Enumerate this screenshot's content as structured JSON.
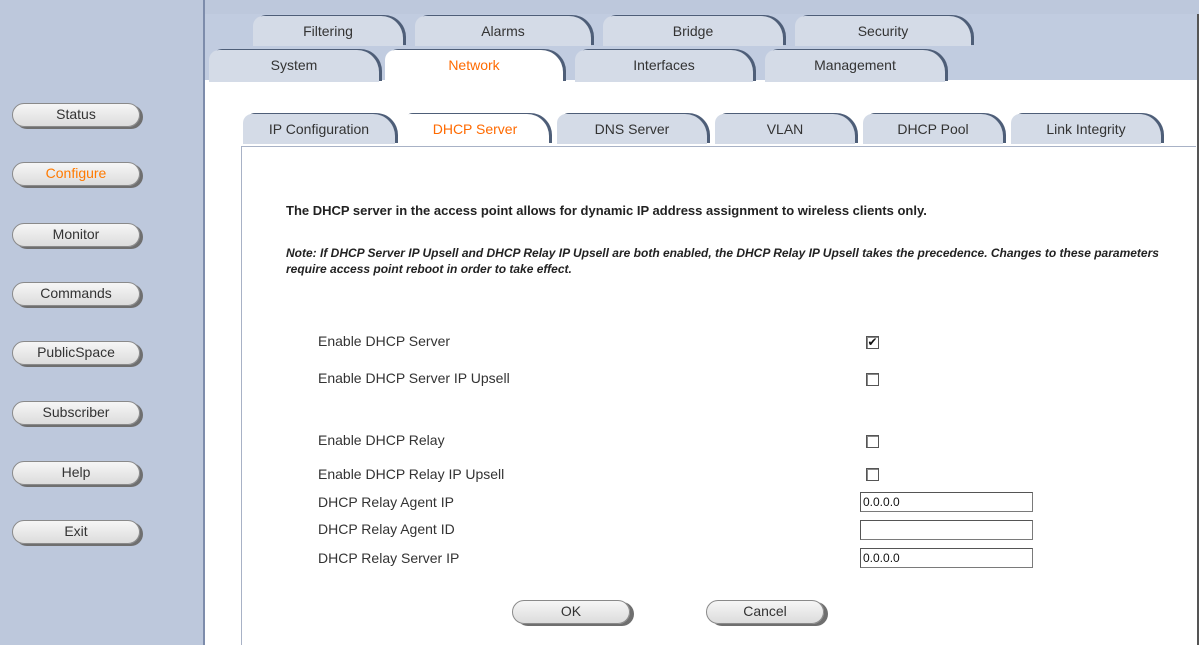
{
  "sidebar": {
    "items": [
      {
        "label": "Status",
        "active": false
      },
      {
        "label": "Configure",
        "active": true
      },
      {
        "label": "Monitor",
        "active": false
      },
      {
        "label": "Commands",
        "active": false
      },
      {
        "label": "PublicSpace",
        "active": false
      },
      {
        "label": "Subscriber",
        "active": false
      },
      {
        "label": "Help",
        "active": false
      },
      {
        "label": "Exit",
        "active": false
      }
    ]
  },
  "top_tabs_row1": [
    "Filtering",
    "Alarms",
    "Bridge",
    "Security"
  ],
  "top_tabs_row2": [
    "System",
    "Network",
    "Interfaces",
    "Management"
  ],
  "top_tabs_active": "Network",
  "sub_tabs": [
    "IP Configuration",
    "DHCP Server",
    "DNS Server",
    "VLAN",
    "DHCP Pool",
    "Link Integrity"
  ],
  "sub_tabs_active": "DHCP Server",
  "content": {
    "intro": "The DHCP server in the access point allows for dynamic IP address assignment to wireless clients only.",
    "note": "Note: If DHCP Server IP Upsell and DHCP Relay IP Upsell are both enabled, the DHCP Relay IP Upsell takes the precedence. Changes to these parameters require access point reboot in order to take effect.",
    "fields": {
      "enable_dhcp_server": {
        "label": "Enable DHCP Server",
        "checked": true
      },
      "enable_dhcp_server_ip_upsell": {
        "label": "Enable DHCP Server IP Upsell",
        "checked": false
      },
      "enable_dhcp_relay": {
        "label": "Enable DHCP Relay",
        "checked": false
      },
      "enable_dhcp_relay_ip_upsell": {
        "label": "Enable DHCP Relay IP Upsell",
        "checked": false
      },
      "relay_agent_ip": {
        "label": "DHCP Relay Agent IP",
        "value": "0.0.0.0"
      },
      "relay_agent_id": {
        "label": "DHCP Relay Agent ID",
        "value": ""
      },
      "relay_server_ip": {
        "label": "DHCP Relay Server IP",
        "value": "0.0.0.0"
      }
    },
    "buttons": {
      "ok": "OK",
      "cancel": "Cancel"
    }
  },
  "colors": {
    "sidebar_bg": "#bdc8dc",
    "tab_bg": "#d4dbe7",
    "active_text": "#ff6a00",
    "tab_shadow": "#4e5e78"
  }
}
